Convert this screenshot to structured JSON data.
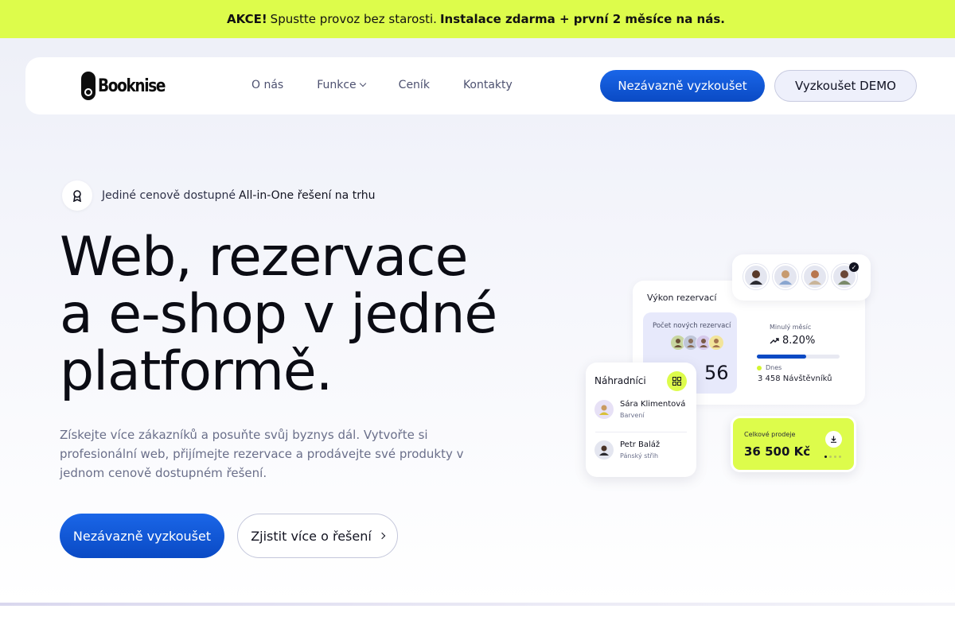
{
  "promo": {
    "label": "AKCE!",
    "text": "Spustte provoz bez starosti.",
    "highlight": "Instalace zdarma + první 2 měsíce na nás."
  },
  "brand": {
    "name": "Booknise"
  },
  "nav": {
    "links": [
      "O nás",
      "Funkce",
      "Ceník",
      "Kontakty"
    ],
    "cta_primary": "Nezávazně vyzkoušet",
    "cta_secondary": "Vyzkoušet DEMO"
  },
  "hero": {
    "badge_text": "Jediné cenově dostupné",
    "badge_strong": "All-in-One řešení na trhu",
    "headline": [
      "Web, rezervace",
      "a e-shop v jedné",
      "platformě."
    ],
    "subtitle": "Získejte více zákazníků a posuňte svůj byznys dál. Vytvořte si profesionální web, přijímejte rezervace a prodávejte své produkty v jednom cenově dostupném řešení.",
    "cta_primary": "Nezávazně vyzkoušet",
    "cta_secondary": "Zjistit více o řešení"
  },
  "dashboard": {
    "performance_title": "Výkon rezervací",
    "new_reservations_label": "Počet nových rezervací",
    "new_reservations_value": "56",
    "last_month_label": "Minulý měsíc",
    "last_month_pct": "8.20%",
    "progress": 0.6,
    "today_label": "Dnes",
    "visits": "3 458 Návštěvníků",
    "substitutes_title": "Náhradníci",
    "people": [
      {
        "name": "Sára Klimentová",
        "role": "Barvení"
      },
      {
        "name": "Petr Baláž",
        "role": "Pánský střih"
      }
    ],
    "sales_label": "Celkové prodeje",
    "sales_value": "36 500 Kč"
  },
  "colors": {
    "accent_lime": "#ddfc4b",
    "primary_blue": "#0a4ac4"
  },
  "icons": [
    "badge-icon",
    "chevron-down-icon",
    "chevron-right-icon",
    "grid-icon",
    "download-icon",
    "trend-up-icon",
    "check-icon"
  ]
}
